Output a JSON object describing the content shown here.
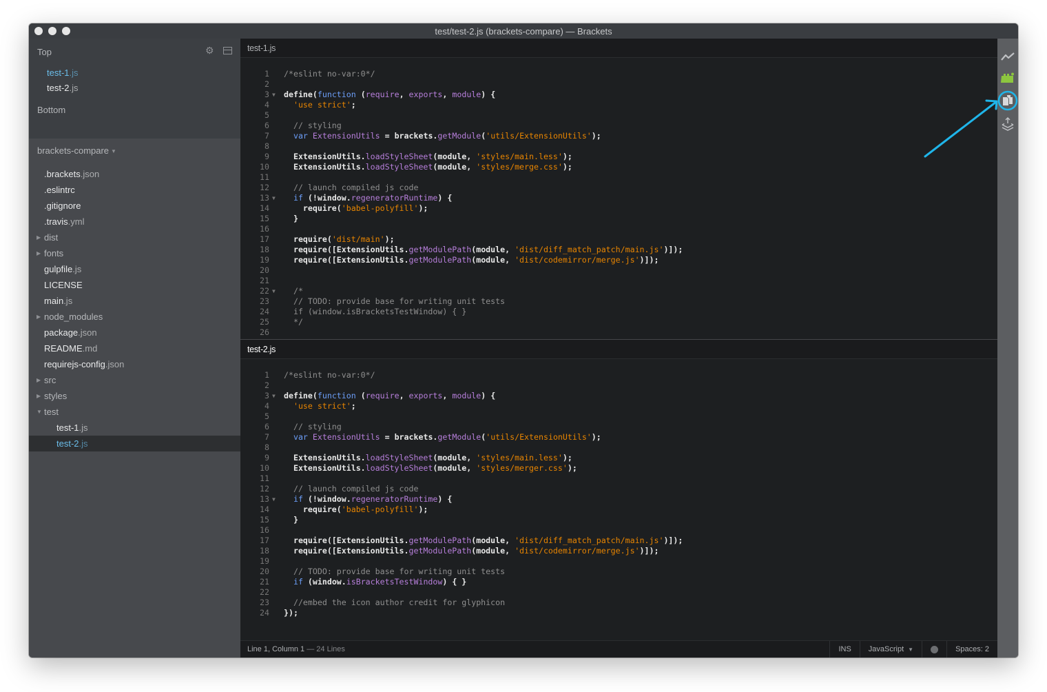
{
  "window": {
    "title": "test/test-2.js (brackets-compare) — Brackets"
  },
  "sidebar": {
    "working_set": {
      "top_label": "Top",
      "bottom_label": "Bottom",
      "files": [
        {
          "name": "test-1",
          "ext": ".js",
          "active": true
        },
        {
          "name": "test-2",
          "ext": ".js",
          "active": false
        }
      ]
    },
    "project": {
      "title": "brackets-compare",
      "tree": [
        {
          "name": ".brackets",
          "ext": ".json",
          "type": "file"
        },
        {
          "name": ".eslintrc",
          "ext": "",
          "type": "file"
        },
        {
          "name": ".gitignore",
          "ext": "",
          "type": "file"
        },
        {
          "name": ".travis",
          "ext": ".yml",
          "type": "file"
        },
        {
          "name": "dist",
          "ext": "",
          "type": "folder",
          "expanded": false
        },
        {
          "name": "fonts",
          "ext": "",
          "type": "folder",
          "expanded": false
        },
        {
          "name": "gulpfile",
          "ext": ".js",
          "type": "file"
        },
        {
          "name": "LICENSE",
          "ext": "",
          "type": "file"
        },
        {
          "name": "main",
          "ext": ".js",
          "type": "file"
        },
        {
          "name": "node_modules",
          "ext": "",
          "type": "folder",
          "expanded": false
        },
        {
          "name": "package",
          "ext": ".json",
          "type": "file"
        },
        {
          "name": "README",
          "ext": ".md",
          "type": "file"
        },
        {
          "name": "requirejs-config",
          "ext": ".json",
          "type": "file"
        },
        {
          "name": "src",
          "ext": "",
          "type": "folder",
          "expanded": false
        },
        {
          "name": "styles",
          "ext": "",
          "type": "folder",
          "expanded": false
        },
        {
          "name": "test",
          "ext": "",
          "type": "folder",
          "expanded": true
        },
        {
          "name": "test-1",
          "ext": ".js",
          "type": "file",
          "child": true
        },
        {
          "name": "test-2",
          "ext": ".js",
          "type": "file",
          "child": true,
          "selected": true
        }
      ]
    }
  },
  "panes": [
    {
      "filename": "test-1.js",
      "active": false,
      "lines": [
        {
          "n": 1,
          "fold": false,
          "tokens": [
            [
              "c-com",
              "/*eslint no-var:0*/"
            ]
          ]
        },
        {
          "n": 2,
          "fold": false,
          "tokens": []
        },
        {
          "n": 3,
          "fold": true,
          "tokens": [
            [
              "",
              "define("
            ],
            [
              "c-kw",
              "function"
            ],
            [
              "",
              " ("
            ],
            [
              "c-var",
              "require"
            ],
            [
              "",
              ", "
            ],
            [
              "c-var",
              "exports"
            ],
            [
              "",
              ", "
            ],
            [
              "c-var",
              "module"
            ],
            [
              "",
              ") {"
            ]
          ]
        },
        {
          "n": 4,
          "fold": false,
          "tokens": [
            [
              "",
              "  "
            ],
            [
              "c-str",
              "'use strict'"
            ],
            [
              "",
              ";"
            ]
          ]
        },
        {
          "n": 5,
          "fold": false,
          "tokens": []
        },
        {
          "n": 6,
          "fold": false,
          "tokens": [
            [
              "c-com",
              "  // styling"
            ]
          ]
        },
        {
          "n": 7,
          "fold": false,
          "tokens": [
            [
              "",
              "  "
            ],
            [
              "c-kw",
              "var"
            ],
            [
              "",
              " "
            ],
            [
              "c-var",
              "ExtensionUtils"
            ],
            [
              "",
              " = brackets."
            ],
            [
              "c-prop",
              "getModule"
            ],
            [
              "",
              "("
            ],
            [
              "c-str",
              "'utils/ExtensionUtils'"
            ],
            [
              "",
              ");"
            ]
          ]
        },
        {
          "n": 8,
          "fold": false,
          "tokens": []
        },
        {
          "n": 9,
          "fold": false,
          "tokens": [
            [
              "",
              "  ExtensionUtils."
            ],
            [
              "c-prop",
              "loadStyleSheet"
            ],
            [
              "",
              "(module, "
            ],
            [
              "c-str",
              "'styles/main.less'"
            ],
            [
              "",
              ");"
            ]
          ]
        },
        {
          "n": 10,
          "fold": false,
          "tokens": [
            [
              "",
              "  ExtensionUtils."
            ],
            [
              "c-prop",
              "loadStyleSheet"
            ],
            [
              "",
              "(module, "
            ],
            [
              "c-str",
              "'styles/merge.css'"
            ],
            [
              "",
              ");"
            ]
          ]
        },
        {
          "n": 11,
          "fold": false,
          "tokens": []
        },
        {
          "n": 12,
          "fold": false,
          "tokens": [
            [
              "c-com",
              "  // launch compiled js code"
            ]
          ]
        },
        {
          "n": 13,
          "fold": true,
          "tokens": [
            [
              "",
              "  "
            ],
            [
              "c-kw",
              "if"
            ],
            [
              "",
              " (!window."
            ],
            [
              "c-prop",
              "regeneratorRuntime"
            ],
            [
              "",
              ") {"
            ]
          ]
        },
        {
          "n": 14,
          "fold": false,
          "tokens": [
            [
              "",
              "    require("
            ],
            [
              "c-str",
              "'babel-polyfill'"
            ],
            [
              "",
              ");"
            ]
          ]
        },
        {
          "n": 15,
          "fold": false,
          "tokens": [
            [
              "",
              "  }"
            ]
          ]
        },
        {
          "n": 16,
          "fold": false,
          "tokens": []
        },
        {
          "n": 17,
          "fold": false,
          "tokens": [
            [
              "",
              "  require("
            ],
            [
              "c-str",
              "'dist/main'"
            ],
            [
              "",
              ");"
            ]
          ]
        },
        {
          "n": 18,
          "fold": false,
          "tokens": [
            [
              "",
              "  require([ExtensionUtils."
            ],
            [
              "c-prop",
              "getModulePath"
            ],
            [
              "",
              "(module, "
            ],
            [
              "c-str",
              "'dist/diff_match_patch/main.js'"
            ],
            [
              "",
              ")]);"
            ]
          ]
        },
        {
          "n": 19,
          "fold": false,
          "tokens": [
            [
              "",
              "  require([ExtensionUtils."
            ],
            [
              "c-prop",
              "getModulePath"
            ],
            [
              "",
              "(module, "
            ],
            [
              "c-str",
              "'dist/codemirror/merge.js'"
            ],
            [
              "",
              ")]);"
            ]
          ]
        },
        {
          "n": 20,
          "fold": false,
          "tokens": []
        },
        {
          "n": 21,
          "fold": false,
          "tokens": []
        },
        {
          "n": 22,
          "fold": true,
          "tokens": [
            [
              "c-com",
              "  /*"
            ]
          ]
        },
        {
          "n": 23,
          "fold": false,
          "tokens": [
            [
              "c-com",
              "  // TODO: provide base for writing unit tests"
            ]
          ]
        },
        {
          "n": 24,
          "fold": false,
          "tokens": [
            [
              "c-com",
              "  if (window.isBracketsTestWindow) { }"
            ]
          ]
        },
        {
          "n": 25,
          "fold": false,
          "tokens": [
            [
              "c-com",
              "  */"
            ]
          ]
        },
        {
          "n": 26,
          "fold": false,
          "tokens": []
        }
      ]
    },
    {
      "filename": "test-2.js",
      "active": true,
      "lines": [
        {
          "n": 1,
          "fold": false,
          "tokens": [
            [
              "c-com",
              "/*eslint no-var:0*/"
            ]
          ]
        },
        {
          "n": 2,
          "fold": false,
          "tokens": []
        },
        {
          "n": 3,
          "fold": true,
          "tokens": [
            [
              "",
              "define("
            ],
            [
              "c-kw",
              "function"
            ],
            [
              "",
              " ("
            ],
            [
              "c-var",
              "require"
            ],
            [
              "",
              ", "
            ],
            [
              "c-var",
              "exports"
            ],
            [
              "",
              ", "
            ],
            [
              "c-var",
              "module"
            ],
            [
              "",
              ") {"
            ]
          ]
        },
        {
          "n": 4,
          "fold": false,
          "tokens": [
            [
              "",
              "  "
            ],
            [
              "c-str",
              "'use strict'"
            ],
            [
              "",
              ";"
            ]
          ]
        },
        {
          "n": 5,
          "fold": false,
          "tokens": []
        },
        {
          "n": 6,
          "fold": false,
          "tokens": [
            [
              "c-com",
              "  // styling"
            ]
          ]
        },
        {
          "n": 7,
          "fold": false,
          "tokens": [
            [
              "",
              "  "
            ],
            [
              "c-kw",
              "var"
            ],
            [
              "",
              " "
            ],
            [
              "c-var",
              "ExtensionUtils"
            ],
            [
              "",
              " = brackets."
            ],
            [
              "c-prop",
              "getModule"
            ],
            [
              "",
              "("
            ],
            [
              "c-str",
              "'utils/ExtensionUtils'"
            ],
            [
              "",
              ");"
            ]
          ]
        },
        {
          "n": 8,
          "fold": false,
          "tokens": []
        },
        {
          "n": 9,
          "fold": false,
          "tokens": [
            [
              "",
              "  ExtensionUtils."
            ],
            [
              "c-prop",
              "loadStyleSheet"
            ],
            [
              "",
              "(module, "
            ],
            [
              "c-str",
              "'styles/main.less'"
            ],
            [
              "",
              ");"
            ]
          ]
        },
        {
          "n": 10,
          "fold": false,
          "tokens": [
            [
              "",
              "  ExtensionUtils."
            ],
            [
              "c-prop",
              "loadStyleSheet"
            ],
            [
              "",
              "(module, "
            ],
            [
              "c-str",
              "'styles/merger.css'"
            ],
            [
              "",
              ");"
            ]
          ]
        },
        {
          "n": 11,
          "fold": false,
          "tokens": []
        },
        {
          "n": 12,
          "fold": false,
          "tokens": [
            [
              "c-com",
              "  // launch compiled js code"
            ]
          ]
        },
        {
          "n": 13,
          "fold": true,
          "tokens": [
            [
              "",
              "  "
            ],
            [
              "c-kw",
              "if"
            ],
            [
              "",
              " (!window."
            ],
            [
              "c-prop",
              "regeneratorRuntime"
            ],
            [
              "",
              ") {"
            ]
          ]
        },
        {
          "n": 14,
          "fold": false,
          "tokens": [
            [
              "",
              "    require("
            ],
            [
              "c-str",
              "'babel-polyfill'"
            ],
            [
              "",
              ");"
            ]
          ]
        },
        {
          "n": 15,
          "fold": false,
          "tokens": [
            [
              "",
              "  }"
            ]
          ]
        },
        {
          "n": 16,
          "fold": false,
          "tokens": []
        },
        {
          "n": 17,
          "fold": false,
          "tokens": [
            [
              "",
              "  require([ExtensionUtils."
            ],
            [
              "c-prop",
              "getModulePath"
            ],
            [
              "",
              "(module, "
            ],
            [
              "c-str",
              "'dist/diff_match_patch/main.js'"
            ],
            [
              "",
              ")]);"
            ]
          ]
        },
        {
          "n": 18,
          "fold": false,
          "tokens": [
            [
              "",
              "  require([ExtensionUtils."
            ],
            [
              "c-prop",
              "getModulePath"
            ],
            [
              "",
              "(module, "
            ],
            [
              "c-str",
              "'dist/codemirror/merge.js'"
            ],
            [
              "",
              ")]);"
            ]
          ]
        },
        {
          "n": 19,
          "fold": false,
          "tokens": []
        },
        {
          "n": 20,
          "fold": false,
          "tokens": [
            [
              "c-com",
              "  // TODO: provide base for writing unit tests"
            ]
          ]
        },
        {
          "n": 21,
          "fold": false,
          "tokens": [
            [
              "",
              "  "
            ],
            [
              "c-kw",
              "if"
            ],
            [
              "",
              " (window."
            ],
            [
              "c-prop",
              "isBracketsTestWindow"
            ],
            [
              "",
              ") { }"
            ]
          ]
        },
        {
          "n": 22,
          "fold": false,
          "tokens": []
        },
        {
          "n": 23,
          "fold": false,
          "tokens": [
            [
              "c-com",
              "  //embed the icon author credit for glyphicon"
            ]
          ]
        },
        {
          "n": 24,
          "fold": false,
          "tokens": [
            [
              "",
              "});"
            ]
          ]
        }
      ]
    }
  ],
  "statusbar": {
    "position": "Line 1, Column 1",
    "line_count": "— 24 Lines",
    "mode": "INS",
    "language": "JavaScript",
    "indent": "Spaces: 2"
  },
  "toolbar": {
    "icons": [
      "live-preview-icon",
      "extension-manager-icon",
      "compare-files-icon",
      "deploy-icon"
    ],
    "highlighted": "compare-files-icon"
  },
  "colors": {
    "accent": "#6bbeea",
    "annotation": "#1fb5ea",
    "extension_green": "#8dc63f"
  }
}
